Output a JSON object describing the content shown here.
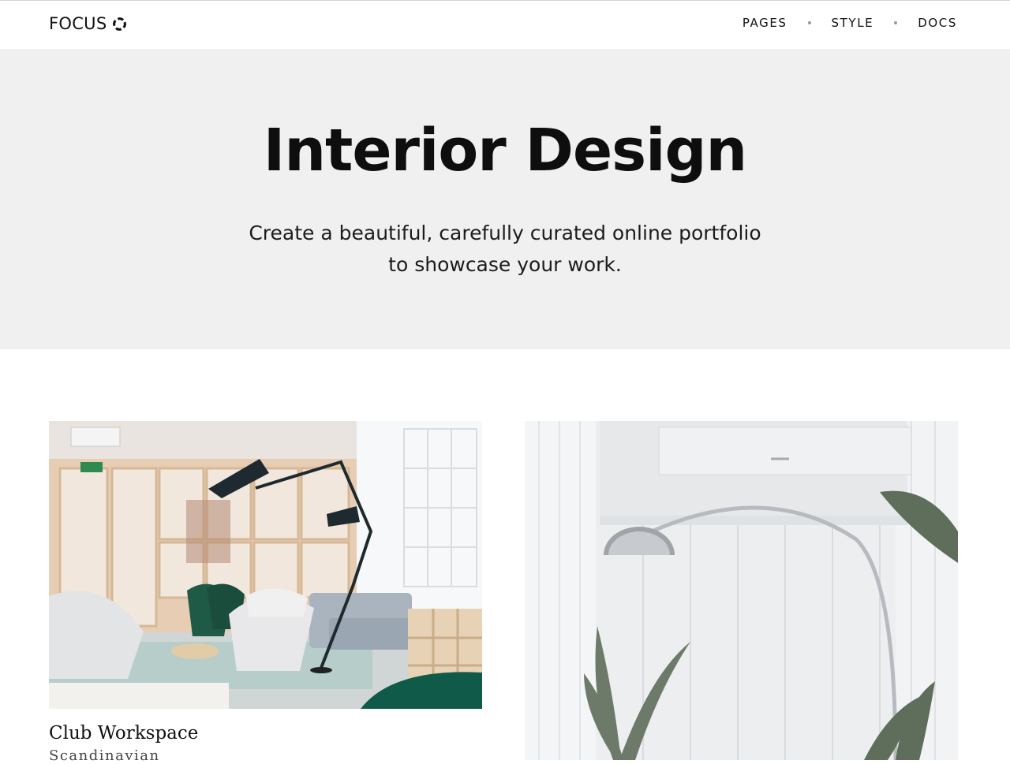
{
  "header": {
    "brand": "FOCUS",
    "brand_icon": "ring-icon",
    "nav": [
      {
        "label": "PAGES"
      },
      {
        "label": "STYLE"
      },
      {
        "label": "DOCS"
      }
    ]
  },
  "hero": {
    "title": "Interior Design",
    "subtitle": "Create a beautiful, carefully curated online portfolio to showcase your work."
  },
  "portfolio": [
    {
      "title": "Club Workspace",
      "subtitle": "Scandinavian"
    },
    {
      "title": "",
      "subtitle": ""
    }
  ],
  "colors": {
    "hero_bg": "#f1f0f1",
    "text": "#111111",
    "nav_dot": "#999999"
  }
}
